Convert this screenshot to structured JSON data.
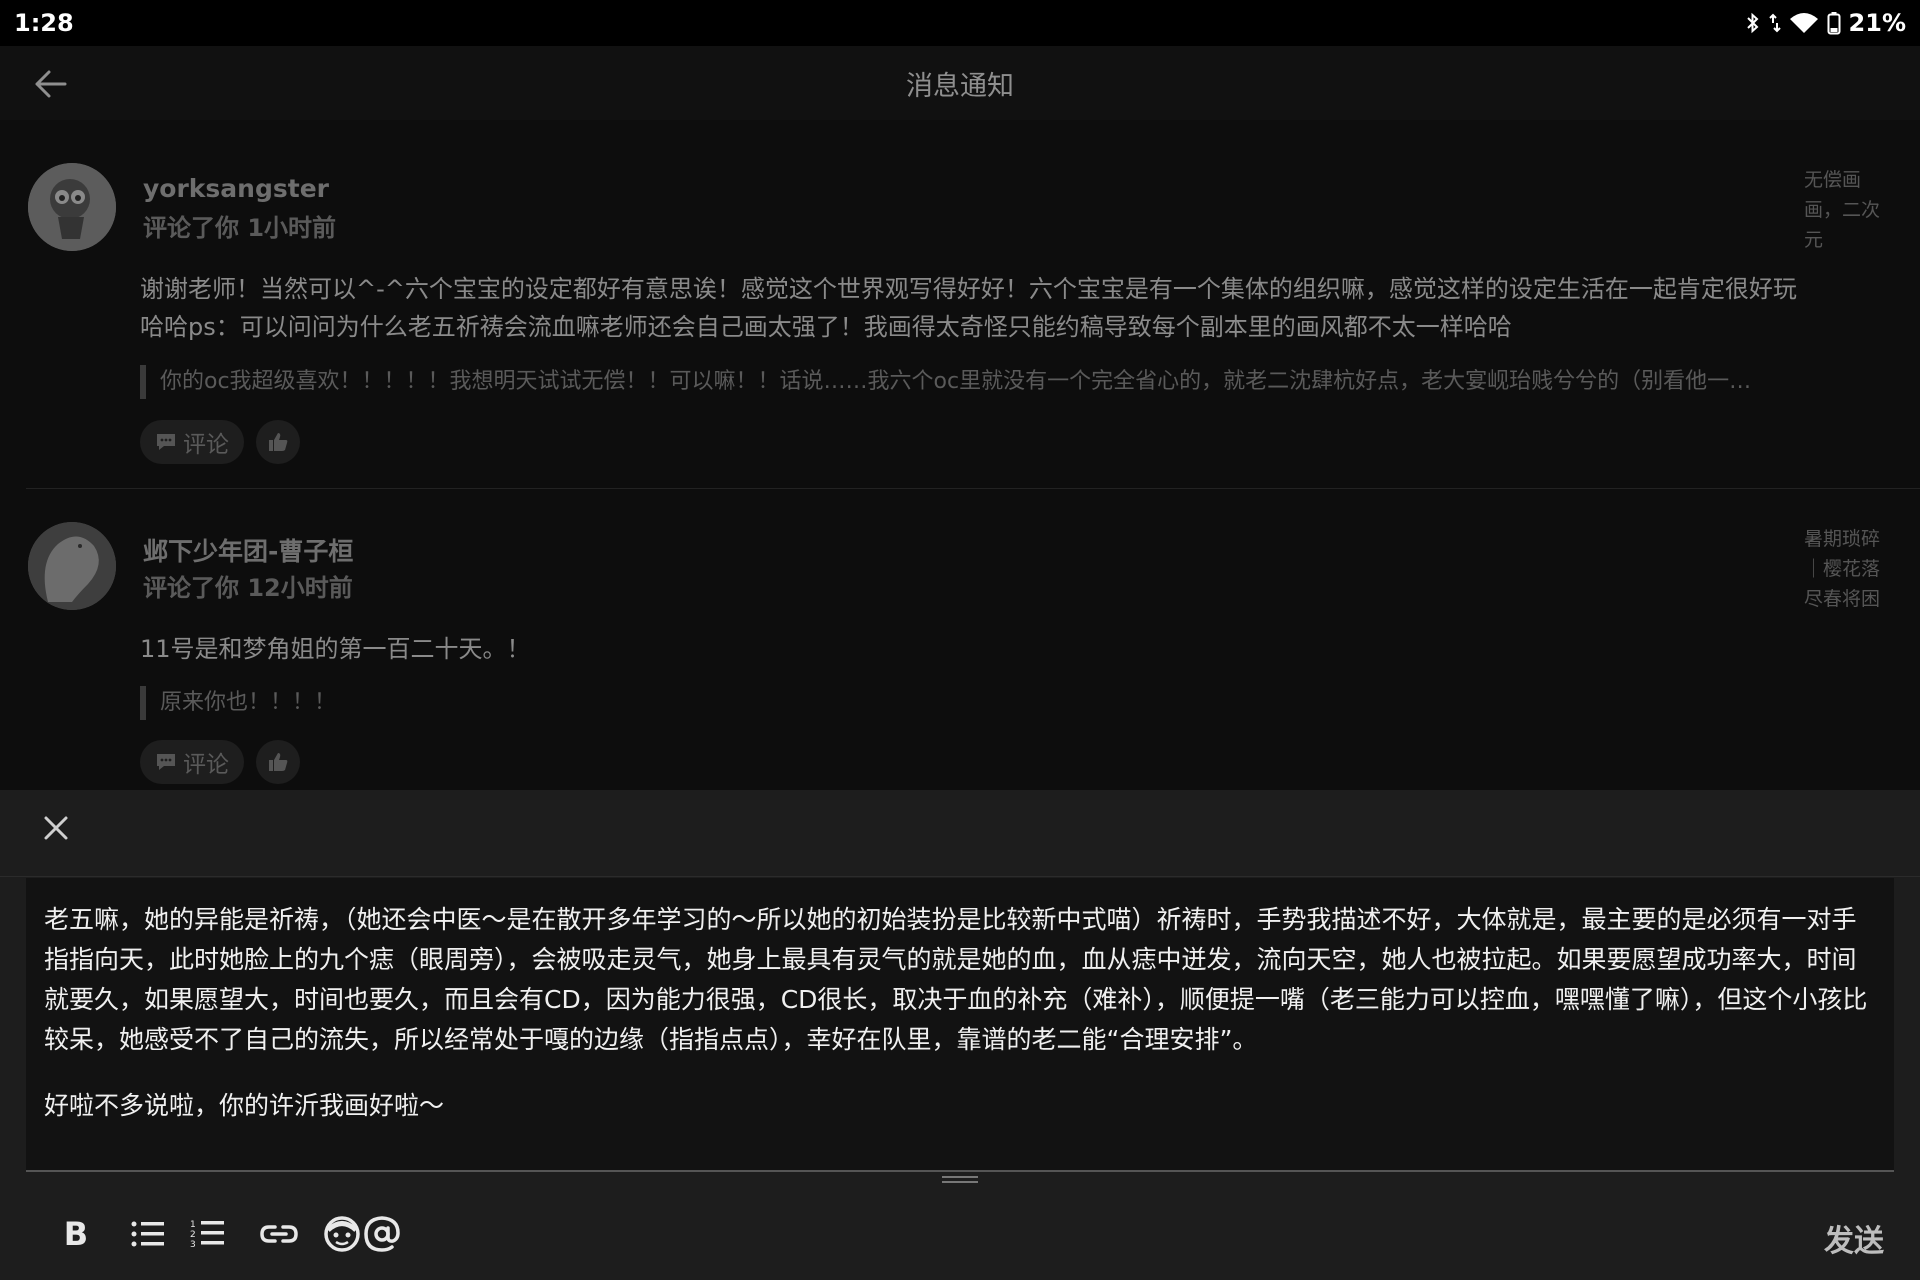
{
  "status_bar": {
    "time": "1:28",
    "battery": "21%",
    "icons": [
      "bluetooth-icon",
      "data-arrows-icon",
      "wifi-icon",
      "battery-icon"
    ]
  },
  "header": {
    "title": "消息通知",
    "back_icon": "arrow-left-icon"
  },
  "notifications": [
    {
      "user": "yorksangster",
      "action": "评论了你 1小时前",
      "tag": "无偿画画，二次元",
      "body": "谢谢老师！当然可以^-^六个宝宝的设定都好有意思诶！感觉这个世界观写得好好！六个宝宝是有一个集体的组织嘛，感觉这样的设定生活在一起肯定很好玩哈哈ps：可以问问为什么老五祈祷会流血嘛老师还会自己画太强了！我画得太奇怪只能约稿导致每个副本里的画风都不太一样哈哈",
      "quote": "你的oc我超级喜欢！！！！！我想明天试试无偿！！可以嘛！！话说……我六个oc里就没有一个完全省心的，就老二沈肆杭好点，老大宴岘珆贱兮兮的（别看他一…",
      "comment_label": "评论"
    },
    {
      "user": "邺下少年团-曹子桓",
      "action": "评论了你 12小时前",
      "tag": "暑期琐碎｜樱花落尽春将困",
      "body": "11号是和梦角姐的第一百二十天。！",
      "quote": "原来你也！！！！",
      "comment_label": "评论"
    }
  ],
  "reply_editor": {
    "paragraph1": "老五嘛，她的异能是祈祷，（她还会中医～是在散开多年学习的～所以她的初始装扮是比较新中式喵）祈祷时，手势我描述不好，大体就是，最主要的是必须有一对手指指向天，此时她脸上的九个痣（眼周旁），会被吸走灵气，她身上最具有灵气的就是她的血，血从痣中迸发，流向天空，她人也被拉起。如果要愿望成功率大，时间就要久，如果愿望大，时间也要久，而且会有CD，因为能力很强，CD很长，取决于血的补充（难补），顺便提一嘴（老三能力可以控血，嘿嘿懂了嘛），但这个小孩比较呆，她感受不了自己的流失，所以经常处于嘎的边缘（指指点点），幸好在队里，靠谱的老二能“合理安排”。",
    "paragraph2": "好啦不多说啦，你的许沂我画好啦～"
  },
  "toolbar": {
    "bold_label": "B",
    "send_label": "发送",
    "tools": [
      "bold-icon",
      "bullet-list-icon",
      "numbered-list-icon",
      "link-icon",
      "emoji-icon",
      "mention-icon"
    ]
  },
  "colors": {
    "background": "#0a0a0a",
    "panel": "#1d1d1d",
    "editor": "#121212",
    "text_primary": "#f0f0f0",
    "text_dim": "#8a8a8a"
  }
}
